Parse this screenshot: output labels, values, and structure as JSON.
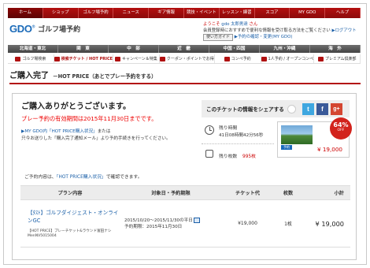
{
  "global_nav": [
    "ホーム",
    "ショップ",
    "ゴルフ場予約",
    "ニュース",
    "ギア情報",
    "競技・イベント",
    "レッスン・練習",
    "スコア",
    "MY GDO",
    "ヘルプ"
  ],
  "logo": {
    "mark": "GDO",
    "reg": "®",
    "title": "ゴルフ場予約"
  },
  "user": {
    "welcome_prefix": "ようこそ",
    "user_name": "gdo 太郎男達",
    "welcome_suffix": "さん",
    "logout": "ログアウト",
    "member_notice": "会員登録時におすすめで便利な情報を受け取る方法をご覧ください",
    "point_label": "使い方ガイド",
    "history_link": "予約の確認・変更(MY GDO)"
  },
  "region_nav": [
    "北海道・東北",
    "関　東",
    "中　部",
    "近　畿",
    "中国・四国",
    "九州・沖縄",
    "海　外"
  ],
  "sub_nav": [
    "ゴルフ場検索",
    "検索チケット / HOT PRICE",
    "キャンペーン＆特集",
    "クーポン・ポイントでお得",
    "コンペ予約",
    "1人予約 / オープンコンペ",
    "プレミアム倶楽部"
  ],
  "page": {
    "title": "ご購入完了",
    "subtitle": "－HOT PRICE（あとでプレー予約をする）"
  },
  "thanks": "ご購入ありがとうございます。",
  "deadline": "プレー予約の有効期間は2015年11月30日までです。",
  "note": {
    "mydgo_link": "MY GDO内「HOT PRICE購入状況」",
    "line1_suffix": "または",
    "line2": "只今お送りした「購入完了通知メール」より予約手続きを行ってください。"
  },
  "share": {
    "label": "このチケットの情報をシェアする"
  },
  "stats": {
    "remaining_time_label": "残り時間",
    "remaining_time_value": "41日08時間42分56秒",
    "remaining_count_label": "残り枚数",
    "remaining_count_value": "995枚"
  },
  "ticket": {
    "tag": "予約",
    "price": "¥ 19,000",
    "discount": "64%",
    "off_label": "OFF"
  },
  "confirm": {
    "prefix": "ご予約内容は、",
    "link": "「HOT PRICE購入状況」",
    "suffix": "で確認できます。"
  },
  "table": {
    "headers": [
      "プラン内容",
      "対象日・予約期限",
      "チケット代",
      "枚数",
      "小計"
    ],
    "rows": [
      {
        "plan_name": "【ﾀｽﾄ】ゴルフダイジェスト・オンラインGC",
        "plan_desc": "【HOT PRICE】プレーチケット&ラウンド富田ナシ MenNV5015004",
        "date_range": "2015/10/20～2015/11/30の平日",
        "deadline": "予約期限：2015年11月30日",
        "price": "¥19,000",
        "qty": "1枚",
        "subtotal": "¥ 19,000"
      }
    ]
  },
  "colors": {
    "brand_red": "#b30f0f",
    "link_blue": "#1a5fa8",
    "alert_red": "#e00000"
  }
}
